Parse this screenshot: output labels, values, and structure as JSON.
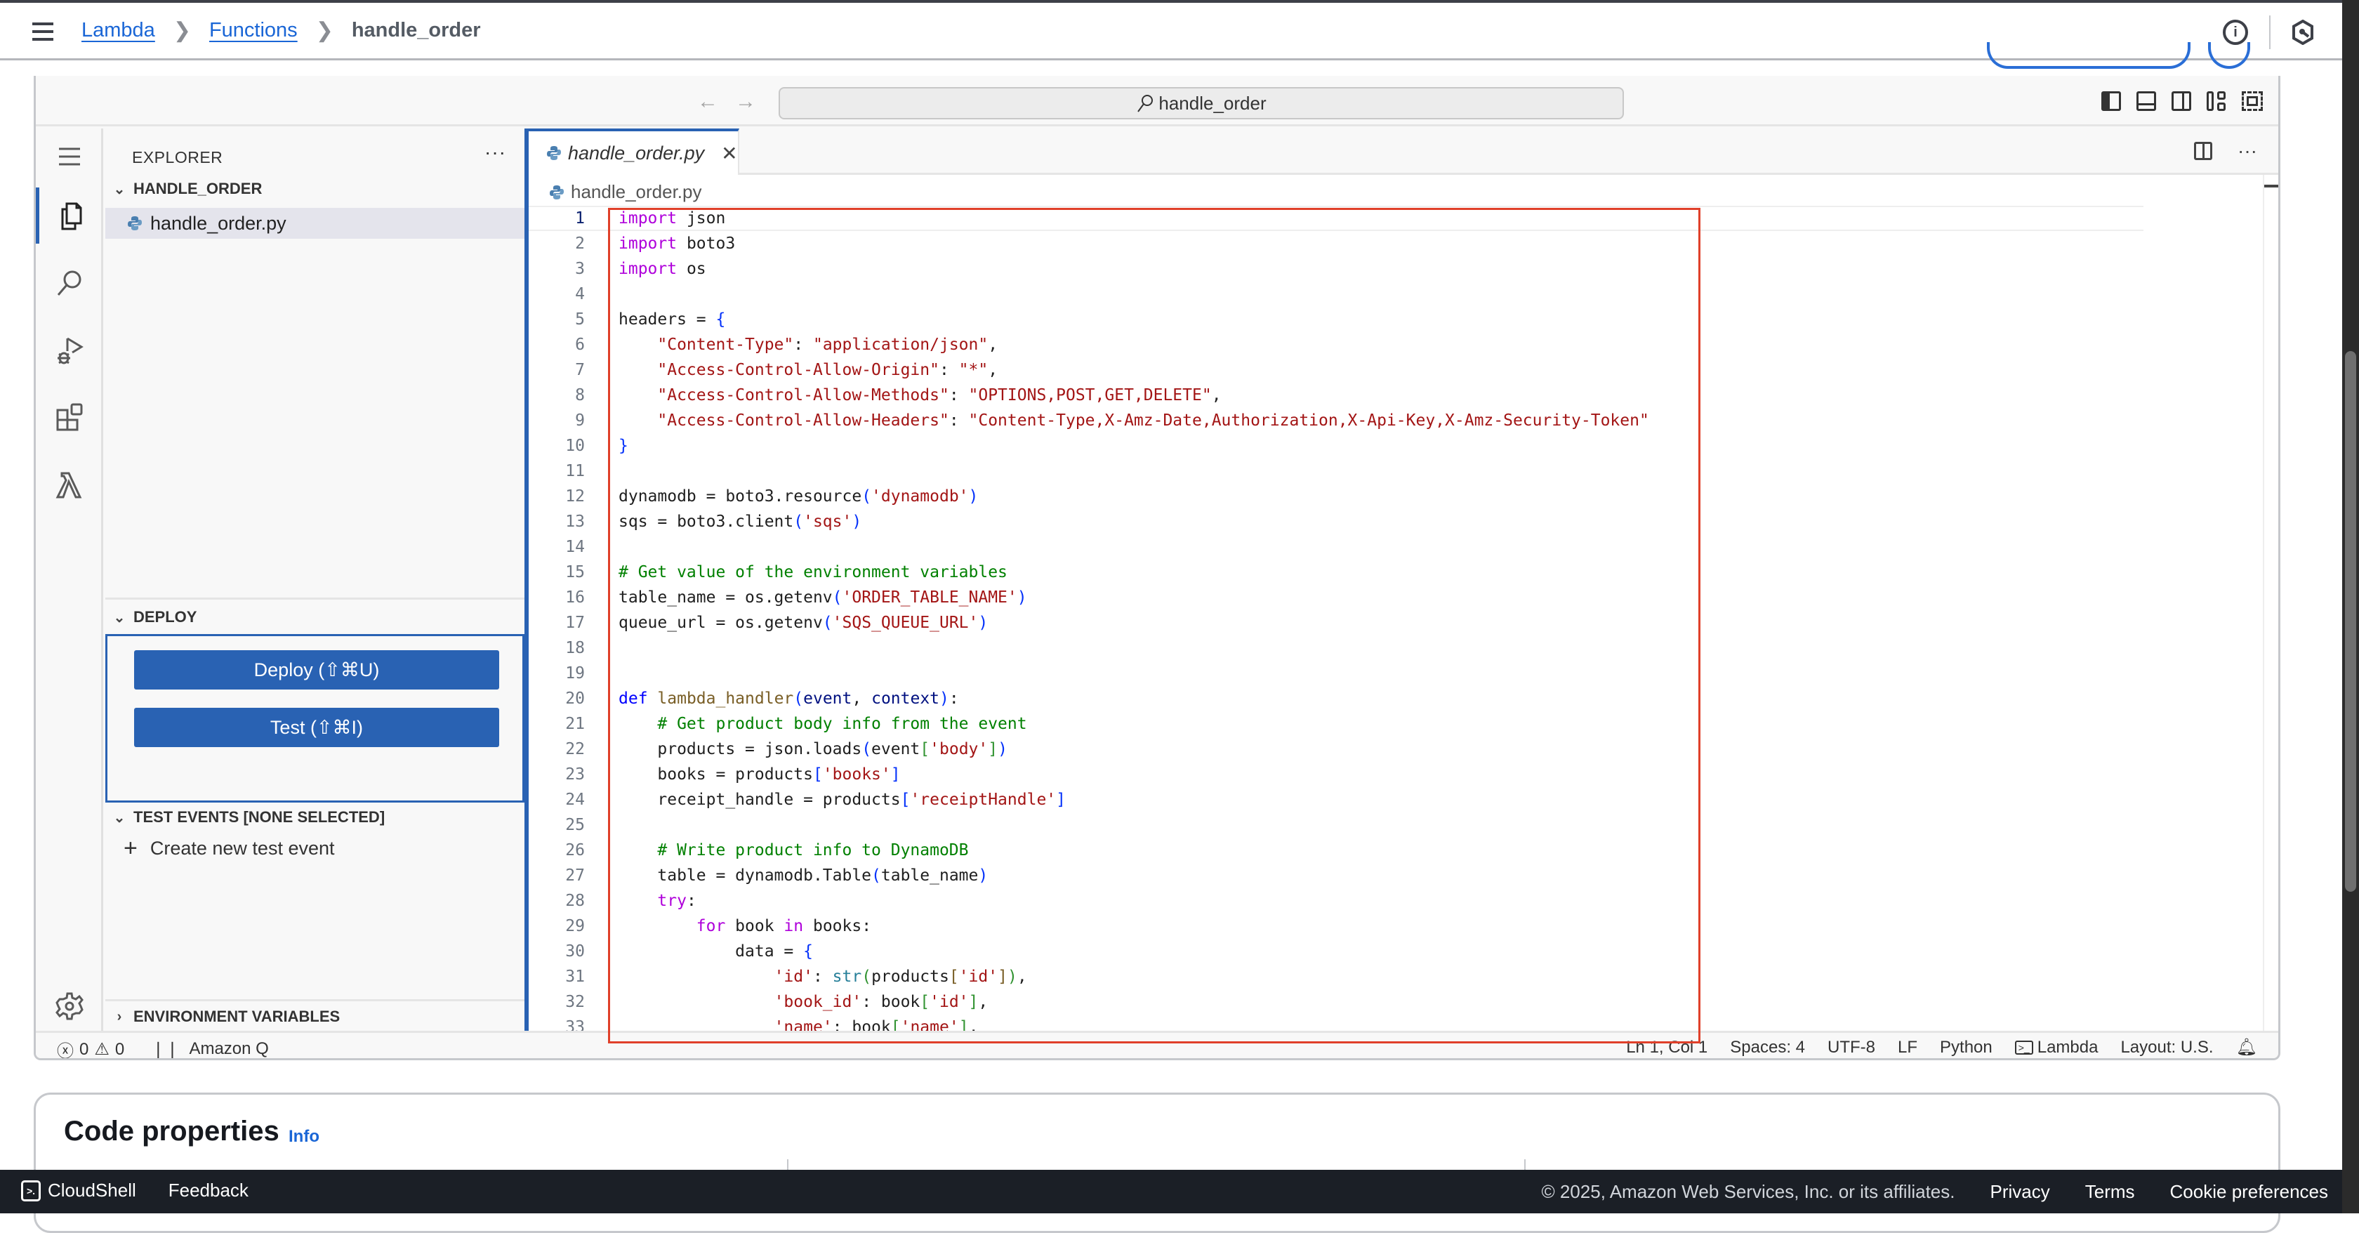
{
  "header": {
    "breadcrumb": [
      {
        "label": "Lambda",
        "link": true
      },
      {
        "label": "Functions",
        "link": true
      },
      {
        "label": "handle_order",
        "link": false
      }
    ],
    "separator": "❯",
    "info_icon": "info-circle-icon",
    "settings_icon": "hexagon-settings-icon"
  },
  "ide": {
    "nav_back": "←",
    "nav_forward": "→",
    "command_center": {
      "icon": "search-icon",
      "text": "handle_order"
    },
    "layout_controls": [
      "toggle-primary-sidebar",
      "toggle-panel",
      "toggle-secondary-sidebar",
      "customize-layout",
      "toggle-fullscreen"
    ],
    "activity_bar": [
      "menu",
      "explorer",
      "search",
      "run-and-debug",
      "extensions",
      "lambda",
      "settings"
    ],
    "explorer": {
      "title": "EXPLORER",
      "more": "···",
      "folder": "HANDLE_ORDER",
      "files": [
        {
          "name": "handle_order.py",
          "selected": true
        }
      ]
    },
    "deploy": {
      "title": "DEPLOY",
      "deploy_label": "Deploy (⇧⌘U)",
      "test_label": "Test (⇧⌘I)"
    },
    "test_events": {
      "title": "TEST EVENTS [NONE SELECTED]",
      "create_label": "Create new test event"
    },
    "env_vars": {
      "title": "ENVIRONMENT VARIABLES"
    },
    "editor": {
      "tab_label": "handle_order.py",
      "close": "✕",
      "breadcrumb_file": "handle_order.py",
      "more": "···",
      "active_line": 1,
      "lines": [
        {
          "n": 1,
          "html": "<span class=\"kw\">import</span> json"
        },
        {
          "n": 2,
          "html": "<span class=\"kw\">import</span> boto3"
        },
        {
          "n": 3,
          "html": "<span class=\"kw\">import</span> os"
        },
        {
          "n": 4,
          "html": ""
        },
        {
          "n": 5,
          "html": "headers = <span class=\"br\">{</span>"
        },
        {
          "n": 6,
          "html": "    <span class=\"str\">\"Content-Type\"</span>: <span class=\"str\">\"application/json\"</span>,"
        },
        {
          "n": 7,
          "html": "    <span class=\"str\">\"Access-Control-Allow-Origin\"</span>: <span class=\"str\">\"*\"</span>,"
        },
        {
          "n": 8,
          "html": "    <span class=\"str\">\"Access-Control-Allow-Methods\"</span>: <span class=\"str\">\"OPTIONS,POST,GET,DELETE\"</span>,"
        },
        {
          "n": 9,
          "html": "    <span class=\"str\">\"Access-Control-Allow-Headers\"</span>: <span class=\"str\">\"Content-Type,X-Amz-Date,Authorization,X-Api-Key,X-Amz-Security-Token\"</span>"
        },
        {
          "n": 10,
          "html": "<span class=\"br\">}</span>"
        },
        {
          "n": 11,
          "html": ""
        },
        {
          "n": 12,
          "html": "dynamodb = boto3.resource<span class=\"br\">(</span><span class=\"str\">'dynamodb'</span><span class=\"br\">)</span>"
        },
        {
          "n": 13,
          "html": "sqs = boto3.client<span class=\"br\">(</span><span class=\"str\">'sqs'</span><span class=\"br\">)</span>"
        },
        {
          "n": 14,
          "html": ""
        },
        {
          "n": 15,
          "html": "<span class=\"cm\"># Get value of the environment variables</span>"
        },
        {
          "n": 16,
          "html": "table_name = os.getenv<span class=\"br\">(</span><span class=\"str\">'ORDER_TABLE_NAME'</span><span class=\"br\">)</span>"
        },
        {
          "n": 17,
          "html": "queue_url = os.getenv<span class=\"br\">(</span><span class=\"str\">'SQS_QUEUE_URL'</span><span class=\"br\">)</span>"
        },
        {
          "n": 18,
          "html": ""
        },
        {
          "n": 19,
          "html": ""
        },
        {
          "n": 20,
          "html": "<span class=\"kw2\">def</span> <span class=\"fn\">lambda_handler</span><span class=\"br\">(</span><span class=\"prm\">event</span>, <span class=\"prm\">context</span><span class=\"br\">)</span>:"
        },
        {
          "n": 21,
          "html": "    <span class=\"cm\"># Get product body info from the event</span>"
        },
        {
          "n": 22,
          "html": "    products = json.loads<span class=\"br\">(</span>event<span class=\"br2\">[</span><span class=\"str\">'body'</span><span class=\"br2\">]</span><span class=\"br\">)</span>"
        },
        {
          "n": 23,
          "html": "    books = products<span class=\"br\">[</span><span class=\"str\">'books'</span><span class=\"br\">]</span>"
        },
        {
          "n": 24,
          "html": "    receipt_handle = products<span class=\"br\">[</span><span class=\"str\">'receiptHandle'</span><span class=\"br\">]</span>"
        },
        {
          "n": 25,
          "html": ""
        },
        {
          "n": 26,
          "html": "    <span class=\"cm\"># Write product info to DynamoDB</span>"
        },
        {
          "n": 27,
          "html": "    table = dynamodb.Table<span class=\"br\">(</span>table_name<span class=\"br\">)</span>"
        },
        {
          "n": 28,
          "html": "    <span class=\"kw\">try</span>:"
        },
        {
          "n": 29,
          "html": "        <span class=\"kw\">for</span> book <span class=\"kw\">in</span> books:"
        },
        {
          "n": 30,
          "html": "            data = <span class=\"br\">{</span>"
        },
        {
          "n": 31,
          "html": "                <span class=\"str\">'id'</span>: <span class=\"bi\">str</span><span class=\"br2\">(</span>products<span class=\"fn\">[</span><span class=\"str\">'id'</span><span class=\"fn\">]</span><span class=\"br2\">)</span>,"
        },
        {
          "n": 32,
          "html": "                <span class=\"str\">'book_id'</span>: book<span class=\"br2\">[</span><span class=\"str\">'id'</span><span class=\"br2\">]</span>,"
        },
        {
          "n": 33,
          "html": "                <span class=\"str\">'name'</span>: book<span class=\"br2\">[</span><span class=\"str\">'name'</span><span class=\"br2\">]</span>,"
        }
      ]
    },
    "status_bar": {
      "errors": "0",
      "warnings": "0",
      "amazon_q": "Amazon Q",
      "position": "Ln 1, Col 1",
      "spaces": "Spaces: 4",
      "encoding": "UTF-8",
      "eol": "LF",
      "language": "Python",
      "runtime": "Lambda",
      "layout": "Layout: U.S."
    }
  },
  "code_properties": {
    "title": "Code properties",
    "info": "Info"
  },
  "footer": {
    "cloudshell": "CloudShell",
    "feedback": "Feedback",
    "copyright": "© 2025, Amazon Web Services, Inc. or its affiliates.",
    "privacy": "Privacy",
    "terms": "Terms",
    "cookies": "Cookie preferences"
  },
  "colors": {
    "accent": "#2962b3",
    "link": "#1a66d6",
    "highlight_box": "#e0402a",
    "footer_bg": "#1b1f26"
  }
}
